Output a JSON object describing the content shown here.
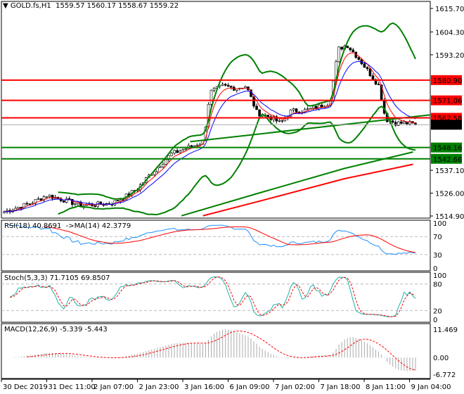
{
  "header": {
    "symbol": "GOLD.fs,H1",
    "ohlc": "1559.57 1560.17 1558.67 1559.22"
  },
  "colors": {
    "up": "#00a000",
    "down": "#000000",
    "bands": "#008000",
    "ma_fast": "#ff0000",
    "ma_slow": "#0000ff",
    "resistance": "#ff0000",
    "support": "#008000",
    "rsi": "#1e90ff",
    "stoch": "#20b2aa"
  },
  "chart_data": [
    {
      "type": "candlestick",
      "title": "GOLD.fs,H1",
      "ylim": [
        1514.9,
        1615.7
      ],
      "yticks": [
        "1615.70",
        "1604.30",
        "1593.20",
        "1537.10",
        "1526.00",
        "1514.90"
      ],
      "levels": [
        {
          "value": 1580.9,
          "label": "1580.90",
          "color": "#ff0000"
        },
        {
          "value": 1571.06,
          "label": "1571.06",
          "color": "#ff0000"
        },
        {
          "value": 1562.58,
          "label": "1562.58",
          "color": "#ff0000"
        },
        {
          "value": 1548.16,
          "label": "1548.16",
          "color": "#008000"
        },
        {
          "value": 1542.66,
          "label": "1542.66",
          "color": "#008000"
        }
      ],
      "current_price": {
        "value": 1559.22,
        "label": "1559.22"
      },
      "trendline": [
        [
          0.44,
          1551
        ],
        [
          1,
          1564
        ]
      ],
      "close_keypoints": [
        [
          0,
          1517
        ],
        [
          0.06,
          1521
        ],
        [
          0.1,
          1525
        ],
        [
          0.15,
          1522
        ],
        [
          0.18,
          1520
        ],
        [
          0.25,
          1521
        ],
        [
          0.28,
          1524
        ],
        [
          0.31,
          1528
        ],
        [
          0.34,
          1535
        ],
        [
          0.39,
          1545
        ],
        [
          0.44,
          1549
        ],
        [
          0.465,
          1551
        ],
        [
          0.48,
          1575
        ],
        [
          0.51,
          1578
        ],
        [
          0.54,
          1577
        ],
        [
          0.565,
          1578
        ],
        [
          0.59,
          1565
        ],
        [
          0.62,
          1563
        ],
        [
          0.645,
          1560
        ],
        [
          0.67,
          1566
        ],
        [
          0.7,
          1566
        ],
        [
          0.735,
          1568
        ],
        [
          0.76,
          1570
        ],
        [
          0.78,
          1596
        ],
        [
          0.8,
          1598
        ],
        [
          0.825,
          1592
        ],
        [
          0.85,
          1585
        ],
        [
          0.875,
          1578
        ],
        [
          0.89,
          1562
        ],
        [
          0.915,
          1560
        ],
        [
          0.94,
          1560
        ],
        [
          0.96,
          1559.22
        ]
      ],
      "long_ma_green": [
        [
          0.42,
          1515
        ],
        [
          0.6,
          1526
        ],
        [
          0.8,
          1538
        ],
        [
          0.96,
          1546
        ]
      ],
      "long_ma_red": [
        [
          0.47,
          1515
        ],
        [
          0.6,
          1522
        ],
        [
          0.8,
          1533
        ],
        [
          0.96,
          1540
        ]
      ],
      "xticks": [
        "30 Dec 2019",
        "31 Dec 11:00",
        "2 Jan 07:00",
        "2 Jan 23:00",
        "3 Jan 16:00",
        "6 Jan 09:00",
        "7 Jan 02:00",
        "7 Jan 18:00",
        "8 Jan 11:00",
        "9 Jan 04:00"
      ]
    },
    {
      "type": "line",
      "title": "RSI(18) 40.8691  ->MA(14) 42.3779",
      "ylim": [
        0,
        100
      ],
      "yticks": [
        "100",
        "70",
        "30",
        "0"
      ],
      "levels": [
        70,
        30
      ]
    },
    {
      "type": "line",
      "title": "Stoch(5,3,3) 71.7105 69.8507",
      "ylim": [
        0,
        100
      ],
      "yticks": [
        "100",
        "80",
        "20",
        "0"
      ],
      "levels": [
        80,
        20
      ]
    },
    {
      "type": "histogram",
      "title": "MACD(12,26,9) -5.339 -5.443",
      "ylim": [
        -6.772,
        11.469
      ],
      "yticks": [
        "11.469",
        "0.00",
        "-6.772"
      ]
    }
  ]
}
